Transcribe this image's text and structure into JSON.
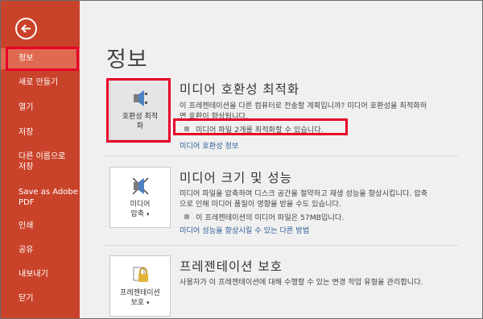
{
  "sidebar": {
    "items": [
      {
        "label": "정보"
      },
      {
        "label": "새로 만들기"
      },
      {
        "label": "열기"
      },
      {
        "label": "저장"
      },
      {
        "label_line1": "다른 이름으로",
        "label_line2": "저장"
      },
      {
        "label_line1": "Save as Adobe",
        "label_line2": "PDF"
      },
      {
        "label": "인쇄"
      },
      {
        "label": "공유"
      },
      {
        "label": "내보내기"
      },
      {
        "label": "닫기"
      }
    ]
  },
  "main": {
    "title": "정보",
    "sections": [
      {
        "tile_line1": "호환성 최적",
        "tile_line2": "화",
        "title": "미디어 호환성 최적화",
        "desc_line1": "이 프레젠테이션을 다른 컴퓨터로 전송할 계획입니까? 미디어 호환성을 최적화하",
        "desc_line2": "면 호환이 향상됩니다.",
        "bullet": "미디어 파일 2개를 최적화할 수 있습니다.",
        "link": "미디어 호환성 정보"
      },
      {
        "tile_line1": "미디어",
        "tile_line2": "압축",
        "title": "미디어 크기 및 성능",
        "desc_line1": "미디어 파일을 압축하여 디스크 공간을 절약하고 재생 성능을 향상시킵니다. 압축",
        "desc_line2": "으로 인해 미디어 품질이 영향을 받을 수도 있습니다.",
        "bullet": "이 프레젠테이션의 미디어 파일은 57MB입니다.",
        "link": "미디어 성능을 향상시킬 수 있는 다른 방법"
      },
      {
        "tile_line1": "프레젠테이션",
        "tile_line2": "보호",
        "title": "프레젠테이션 보호",
        "desc_line1": "사용자가 이 프레젠테이션에 대해 수행할 수 있는 변경 작업 유형을 관리합니다."
      }
    ]
  },
  "colors": {
    "sidebar_bg": "#c9432a",
    "sidebar_active": "#e06a51",
    "highlight": "#e6002a",
    "link": "#2e5f99"
  }
}
